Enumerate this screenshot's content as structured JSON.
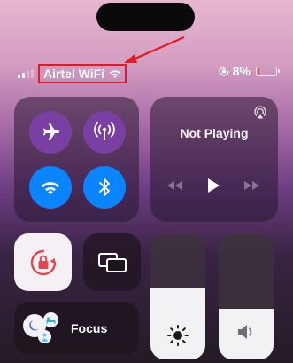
{
  "status_bar": {
    "carrier": "Airtel WiFi",
    "battery_percent": "8%",
    "battery_level": 0.08,
    "signal_bars_active": 2,
    "icons": [
      "cellular-signal-icon",
      "wifi-icon",
      "rotation-lock-icon",
      "battery-icon"
    ],
    "highlight_color": "#e11b22"
  },
  "connectivity": {
    "airplane": {
      "icon": "airplane-icon",
      "state": "off"
    },
    "cellular": {
      "icon": "cellular-antenna-icon",
      "state": "on",
      "color": "#7a3fa2"
    },
    "wifi": {
      "icon": "wifi-icon",
      "state": "on",
      "color": "#0a84ff"
    },
    "bluetooth": {
      "icon": "bluetooth-icon",
      "state": "on",
      "color": "#0a84ff"
    }
  },
  "media": {
    "title": "Not Playing",
    "icons": [
      "airplay-icon",
      "rewind-icon",
      "play-icon",
      "fast-forward-icon"
    ]
  },
  "controls": {
    "rotation_lock": {
      "icon": "rotation-lock-icon",
      "state": "on",
      "accent": "#e0484f"
    },
    "screen_mirroring": {
      "icon": "screen-mirroring-icon"
    }
  },
  "sliders": {
    "brightness": {
      "icon": "sun-icon",
      "level": 0.57
    },
    "volume": {
      "icon": "speaker-icon",
      "level": 0.4
    }
  },
  "focus": {
    "label": "Focus",
    "icons": [
      "moon-icon",
      "bed-icon",
      "person-icon"
    ]
  }
}
